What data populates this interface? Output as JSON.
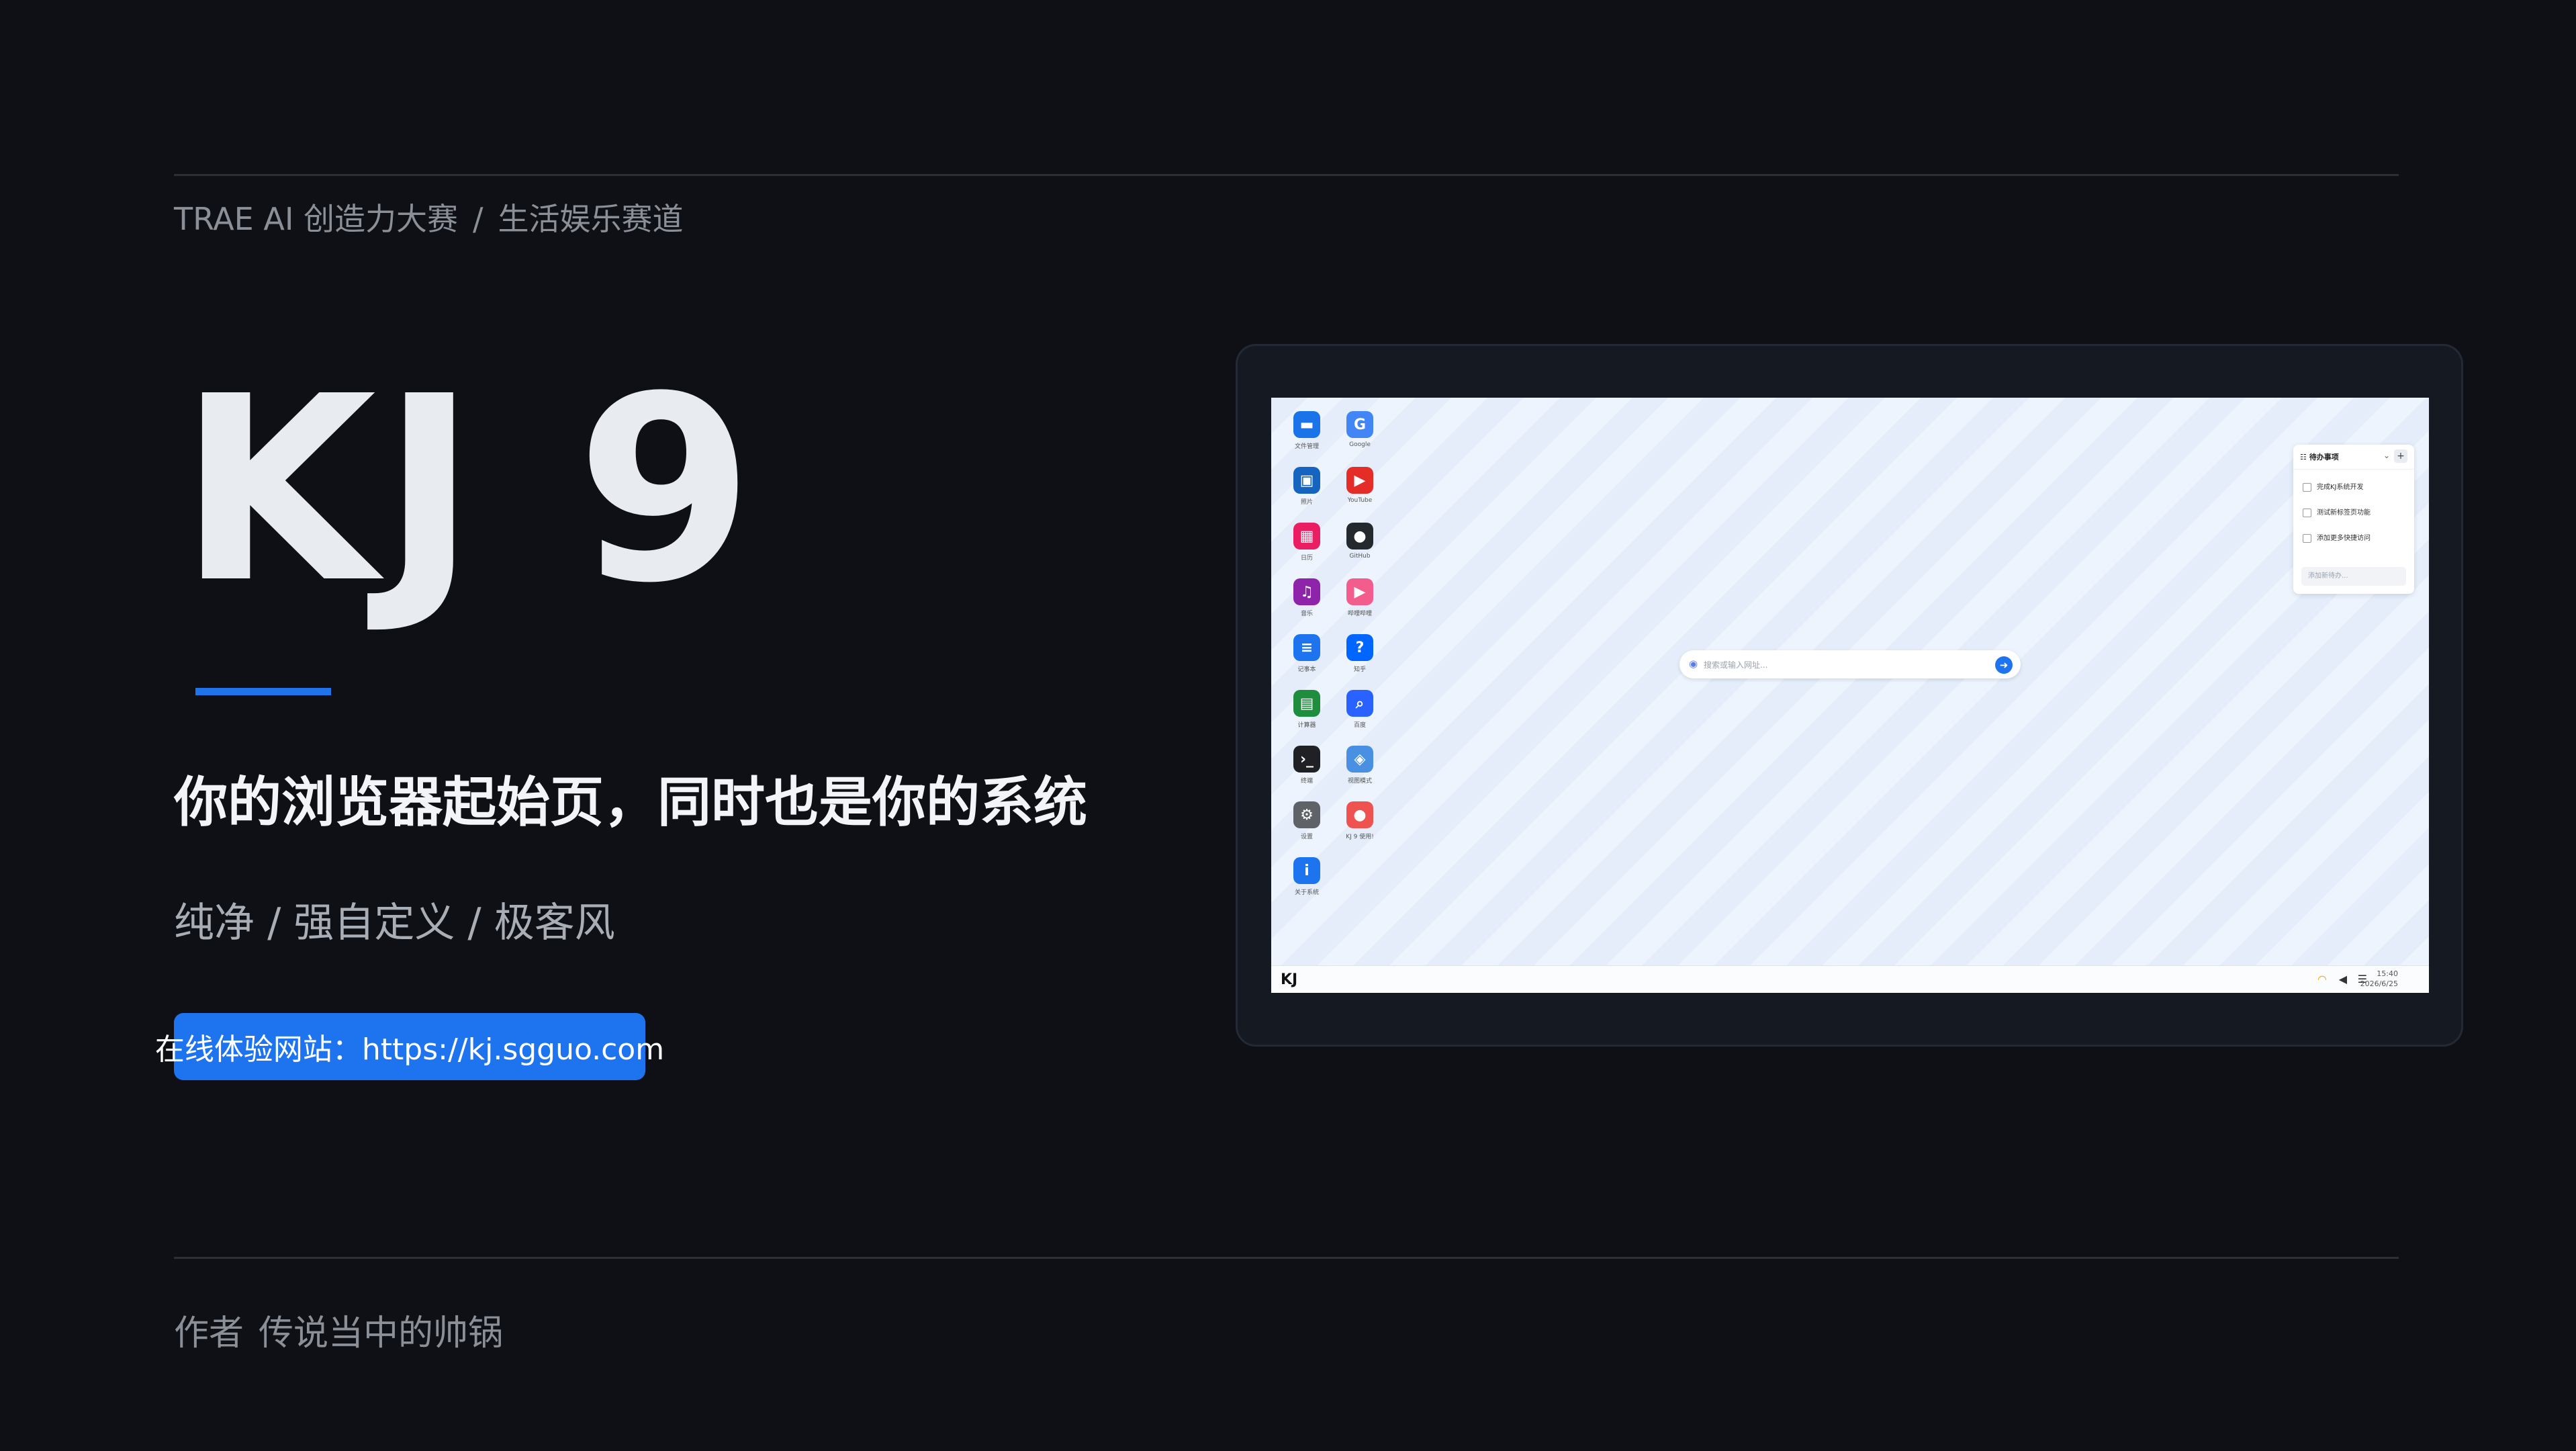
{
  "header": {
    "event": "TRAE AI 创造力大赛",
    "separator": "/",
    "track": "生活娱乐赛道"
  },
  "hero": {
    "title": "KJ 9",
    "tagline": "你的浏览器起始页，同时也是你的系统",
    "features": "纯净 / 强自定义 / 极客风"
  },
  "cta": {
    "label": "在线体验网站：https://kj.sgguo.com"
  },
  "footer": {
    "author_label": "作者",
    "author_name": "传说当中的帅锅"
  },
  "colors": {
    "background": "#0e1015",
    "accent": "#1e74ee",
    "text_muted": "#8a8f98"
  },
  "desktop": {
    "apps_left": [
      {
        "label": "文件管理",
        "icon": "folder-icon",
        "color": "#1a73e8",
        "glyph": "▬"
      },
      {
        "label": "照片",
        "icon": "photos-icon",
        "color": "#1565c0",
        "glyph": "▣"
      },
      {
        "label": "日历",
        "icon": "calendar-icon",
        "color": "#e91e63",
        "glyph": "▦"
      },
      {
        "label": "音乐",
        "icon": "music-icon",
        "color": "#8e24aa",
        "glyph": "♫"
      },
      {
        "label": "记事本",
        "icon": "notepad-icon",
        "color": "#1e74ee",
        "glyph": "≡"
      },
      {
        "label": "计算器",
        "icon": "calculator-icon",
        "color": "#1e8e3e",
        "glyph": "▤"
      },
      {
        "label": "终端",
        "icon": "terminal-icon",
        "color": "#202124",
        "glyph": "›_"
      },
      {
        "label": "设置",
        "icon": "gear-icon",
        "color": "#5f6368",
        "glyph": "⚙"
      },
      {
        "label": "关于系统",
        "icon": "info-icon",
        "color": "#1e74ee",
        "glyph": "i"
      }
    ],
    "apps_right": [
      {
        "label": "Google",
        "icon": "google-icon",
        "color": "#4285f4",
        "glyph": "G"
      },
      {
        "label": "YouTube",
        "icon": "youtube-icon",
        "color": "#e52d27",
        "glyph": "▶"
      },
      {
        "label": "GitHub",
        "icon": "github-icon",
        "color": "#24292e",
        "glyph": "●"
      },
      {
        "label": "哔哩哔哩",
        "icon": "bilibili-icon",
        "color": "#f25d8e",
        "glyph": "▶"
      },
      {
        "label": "知乎",
        "icon": "zhihu-icon",
        "color": "#0066ff",
        "glyph": "?"
      },
      {
        "label": "百度",
        "icon": "baidu-search-icon",
        "color": "#2962ff",
        "glyph": "⌕"
      },
      {
        "label": "视图模式",
        "icon": "view-mode-icon",
        "color": "#4a90e2",
        "glyph": "◈"
      },
      {
        "label": "KJ 9 使用!",
        "icon": "kj9-app-icon",
        "color": "#ef5350",
        "glyph": "●"
      }
    ],
    "search": {
      "placeholder": "搜索或输入网址..."
    },
    "todo": {
      "title": "待办事项",
      "items": [
        "完成KJ系统开发",
        "测试新标签页功能",
        "添加更多快捷访问"
      ],
      "input_placeholder": "添加新待办..."
    },
    "taskbar": {
      "logo": "KJ",
      "time": "15:40",
      "date": "2026/6/25"
    }
  }
}
